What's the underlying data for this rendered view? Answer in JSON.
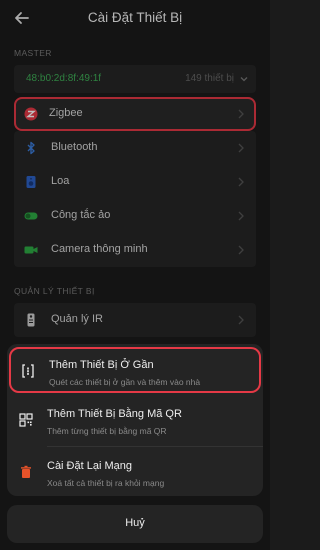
{
  "header": {
    "title": "Cài Đặt Thiết Bị"
  },
  "master": {
    "section_label": "MASTER",
    "mac": "48:b0:2d:8f:49:1f",
    "count": "149 thiết bị"
  },
  "devices": [
    {
      "label": "Zigbee",
      "icon": "zigbee-icon"
    },
    {
      "label": "Bluetooth",
      "icon": "bluetooth-icon"
    },
    {
      "label": "Loa",
      "icon": "speaker-icon"
    },
    {
      "label": "Công tắc ảo",
      "icon": "toggle-icon"
    },
    {
      "label": "Camera thông minh",
      "icon": "camera-icon"
    }
  ],
  "management": {
    "section_label": "QUẢN LÝ THIẾT BỊ",
    "ir_label": "Quản lý IR"
  },
  "sheet": {
    "actions": [
      {
        "title": "Thêm Thiết Bị Ở Gần",
        "subtitle": "Quét các thiết bị ở gần và thêm vào nhà",
        "icon": "scan-nearby-icon"
      },
      {
        "title": "Thêm Thiết Bị Bằng Mã QR",
        "subtitle": "Thêm từng thiết bị bằng mã QR",
        "icon": "qr-code-icon"
      },
      {
        "title": "Cài Đặt Lại Mạng",
        "subtitle": "Xoá tất cả thiết bị ra khỏi mạng",
        "icon": "trash-icon"
      }
    ],
    "cancel_label": "Huỷ"
  },
  "colors": {
    "accent_red": "#e53946",
    "mac_green": "#3fae57",
    "bluetooth_blue": "#3b7bd8",
    "toggle_green": "#2eaa44"
  }
}
